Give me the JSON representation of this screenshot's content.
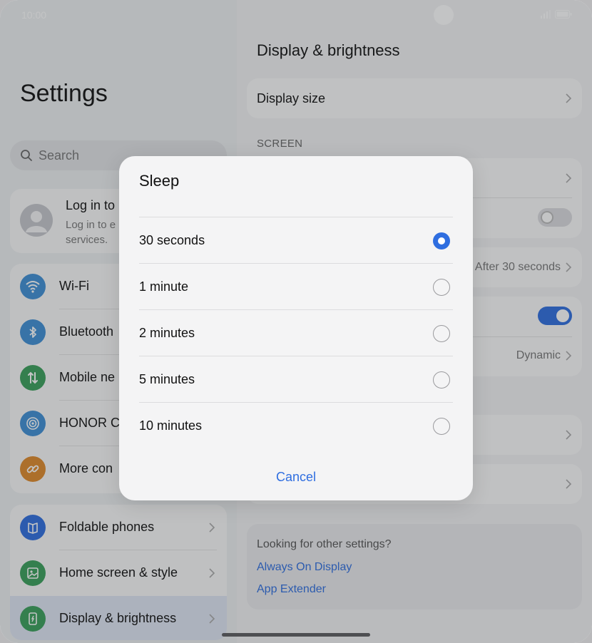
{
  "status": {
    "time": "10:00"
  },
  "left": {
    "title": "Settings",
    "search_placeholder": "Search",
    "login": {
      "title": "Log in to",
      "subtitle": "Log in to e services."
    },
    "network_items": [
      {
        "label": "Wi-Fi",
        "icon": "wifi-icon",
        "color": "#3f8fd6"
      },
      {
        "label": "Bluetooth",
        "icon": "bluetooth-icon",
        "color": "#3f8fd6"
      },
      {
        "label": "Mobile ne",
        "icon": "mobile-data-icon",
        "color": "#3aa05a"
      },
      {
        "label": "HONOR C",
        "icon": "honor-connect-icon",
        "color": "#3f8fd6"
      },
      {
        "label": "More con",
        "icon": "link-icon",
        "color": "#e08a2a"
      }
    ],
    "other_items": [
      {
        "label": "Foldable phones",
        "icon": "book-icon",
        "color": "#2f6ee0"
      },
      {
        "label": "Home screen & style",
        "icon": "image-icon",
        "color": "#3aa05a"
      },
      {
        "label": "Display & brightness",
        "icon": "display-icon",
        "color": "#3aa05a"
      }
    ]
  },
  "right": {
    "title": "Display & brightness",
    "display_size": "Display size",
    "section_screen": "SCREEN",
    "sleep_value": "After 30 seconds",
    "color_mode_value": "Dynamic",
    "footer_question": "Looking for other settings?",
    "links": [
      "Always On Display",
      "App Extender"
    ]
  },
  "dialog": {
    "title": "Sleep",
    "options": [
      "30 seconds",
      "1 minute",
      "2 minutes",
      "5 minutes",
      "10 minutes"
    ],
    "selected": 0,
    "cancel": "Cancel"
  },
  "colors": {
    "accent": "#2f6ee0"
  }
}
